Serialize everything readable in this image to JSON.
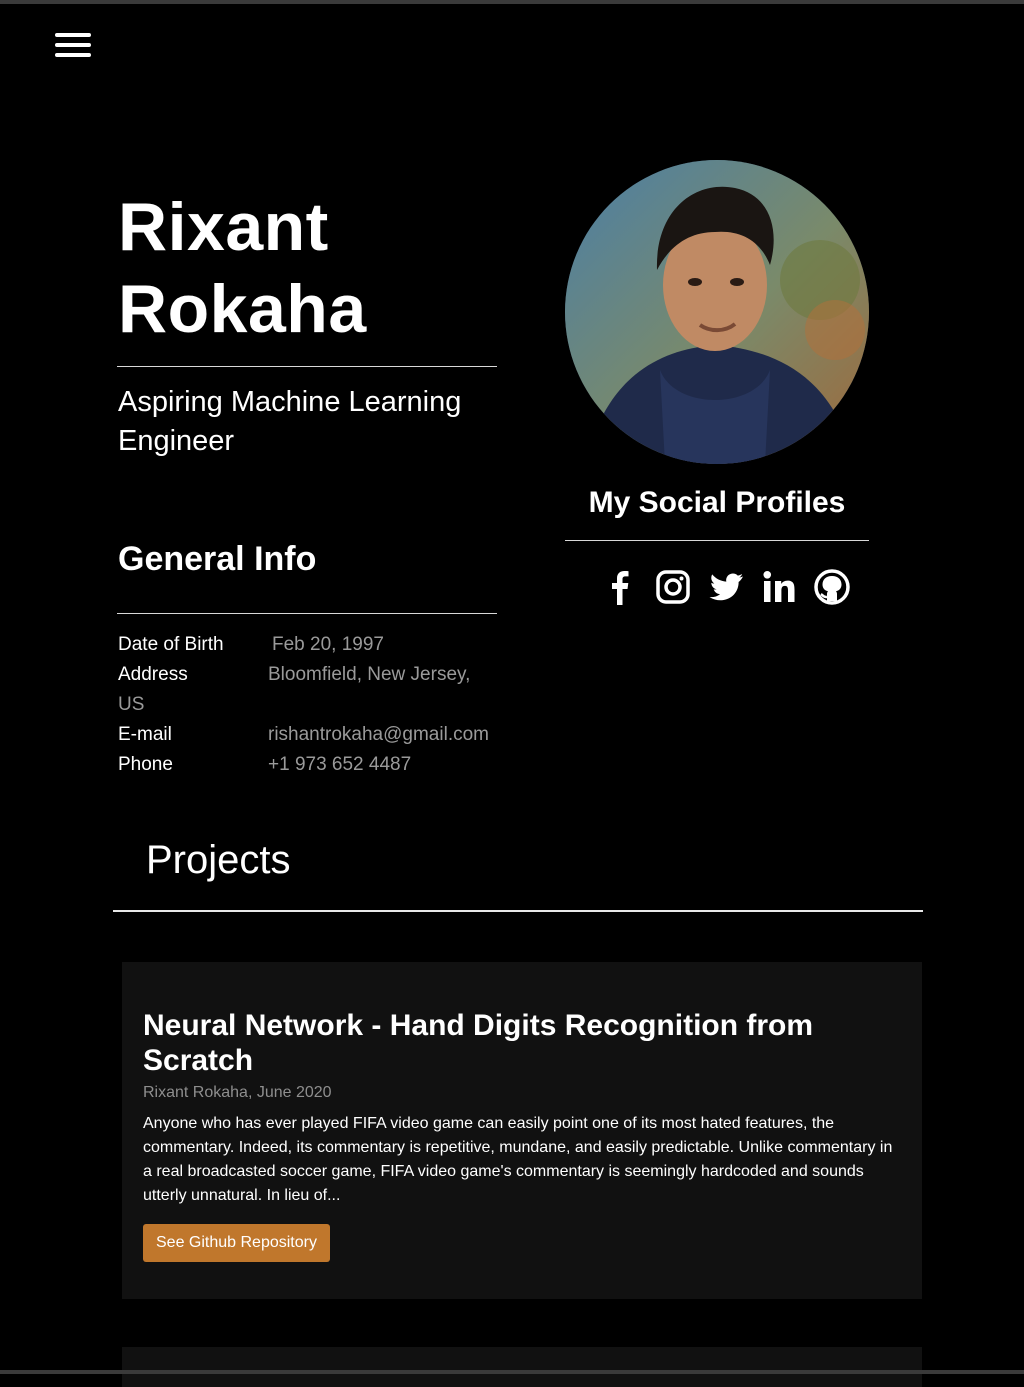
{
  "header": {
    "menu_icon": "hamburger-menu-icon"
  },
  "hero": {
    "first_name": "Rixant",
    "last_name": "Rokaha",
    "role": "Aspiring Machine Learning Engineer"
  },
  "general_info": {
    "title": "General Info",
    "rows": [
      {
        "label": "Date of Birth",
        "value": "Feb 20, 1997"
      },
      {
        "label": "Address",
        "value": "Bloomfield, New Jersey,",
        "value_wrap": "US"
      },
      {
        "label": "E-mail",
        "value": "rishantrokaha@gmail.com"
      },
      {
        "label": "Phone",
        "value": "+1 973 652 4487"
      }
    ]
  },
  "profile": {
    "photo_icon": "profile-photo",
    "social_title": "My Social Profiles",
    "social_icons": [
      "facebook-icon",
      "instagram-icon",
      "twitter-icon",
      "linkedin-icon",
      "github-icon"
    ]
  },
  "projects": {
    "title": "Projects",
    "items": [
      {
        "title": "Neural Network - Hand Digits Recognition from Scratch",
        "meta": "Rixant Rokaha, June 2020",
        "excerpt": "Anyone who has ever played FIFA video game can easily point one of its most hated features, the commentary. Indeed, its commentary is repetitive, mundane, and easily predictable. Unlike commentary in a real broadcasted soccer game, FIFA video game's commentary is seemingly hardcoded and sounds utterly unnatural. In lieu of...",
        "button_label": "See Github Repository"
      }
    ]
  },
  "colors": {
    "background": "#000000",
    "card": "#111111",
    "accent_button": "#c0772c",
    "muted_text": "#9a9a9a"
  }
}
